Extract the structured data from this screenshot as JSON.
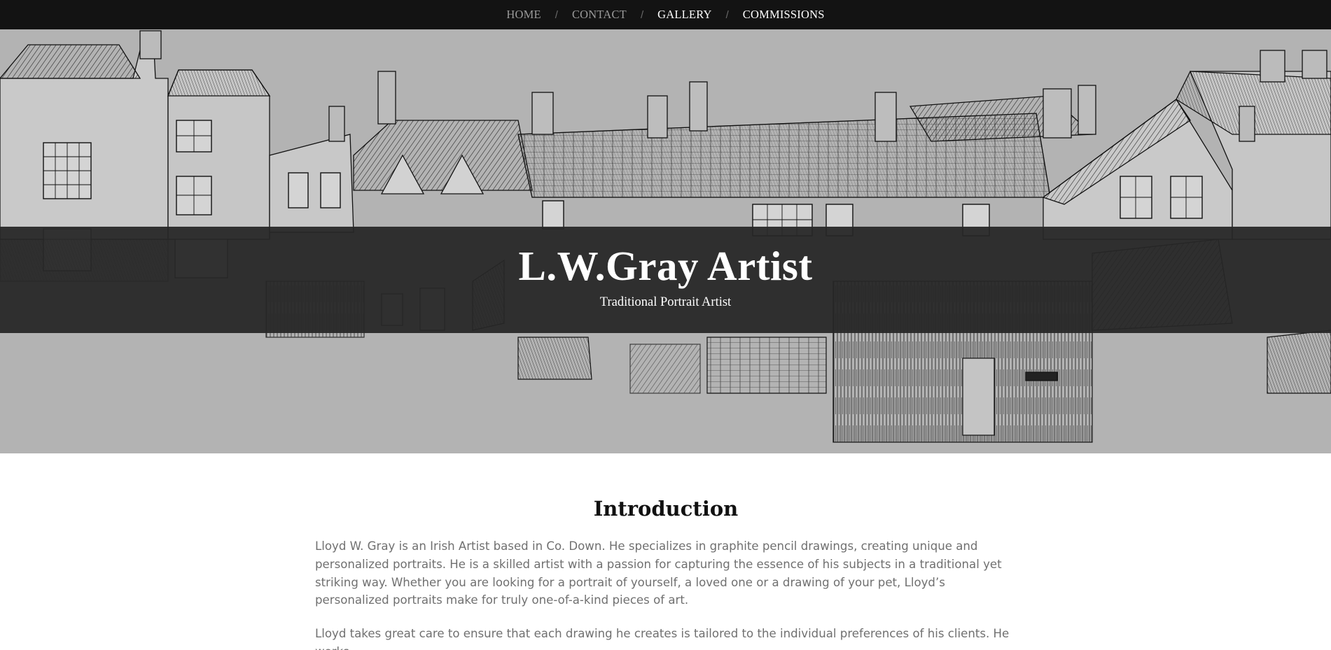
{
  "nav": {
    "items": [
      {
        "label": "HOME",
        "style": "dim"
      },
      {
        "label": "CONTACT",
        "style": "dim"
      },
      {
        "label": "GALLERY",
        "style": "bright"
      },
      {
        "label": "COMMISSIONS",
        "style": "bright"
      }
    ],
    "separator": "/"
  },
  "hero": {
    "title": "L.W.Gray Artist",
    "subtitle": "Traditional Portrait Artist",
    "image_icon": "pencil-sketch-streetscape-image"
  },
  "intro": {
    "heading": "Introduction",
    "paragraphs": [
      "Lloyd W. Gray is an Irish Artist based in Co. Down. He specializes in graphite pencil drawings, creating unique and personalized portraits. He is a skilled artist with a passion for capturing the essence of his subjects in a traditional yet striking way. Whether you are looking for a portrait of yourself, a loved one or a drawing of your pet, Lloyd’s personalized portraits make for truly one-of-a-kind pieces of art.",
      "Lloyd takes great care to ensure that each drawing he creates is tailored to the individual preferences of his clients. He works"
    ]
  },
  "colors": {
    "nav_bg": "#131313",
    "hero_bg": "#b3b3b3",
    "band_bg": "#262626",
    "body_text": "#707070",
    "heading_text": "#111111"
  }
}
